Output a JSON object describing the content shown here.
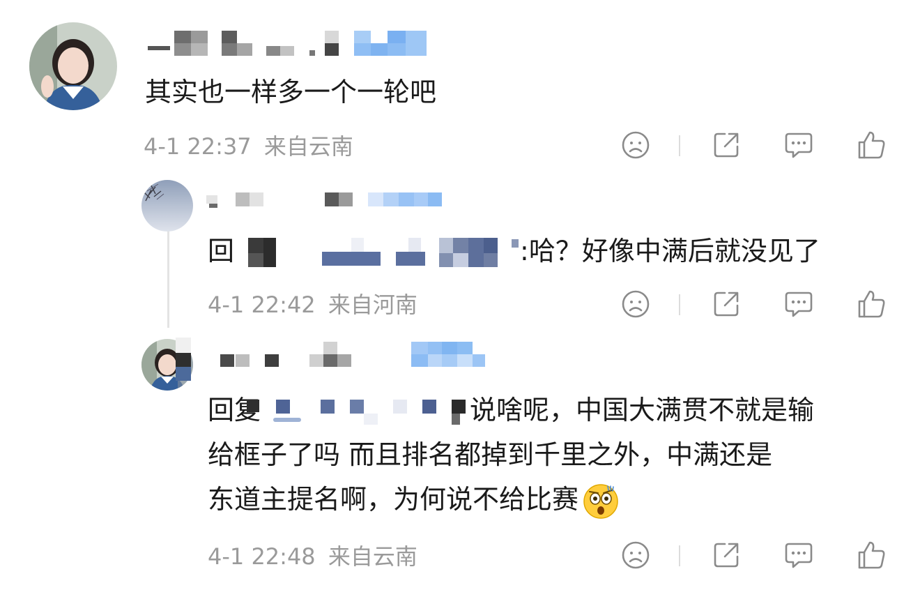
{
  "comments": [
    {
      "text": "其实也一样多一个一轮吧",
      "time": "4-1 22:37",
      "location": "来自云南"
    },
    {
      "text": ":哈？好像中满后就没见了",
      "reply_prefix": "回",
      "time": "4-1 22:42",
      "location": "来自河南"
    },
    {
      "reply_prefix": "回复",
      "line1": "说啥呢，中国大满贯不就是输",
      "line2": "给框子了吗 而且排名都掉到千里之外，中满还是",
      "line3": "东道主提名啊，为何说不给比赛",
      "time": "4-1 22:48",
      "location": "来自云南"
    }
  ],
  "icons": [
    "sad-face-icon",
    "share-icon",
    "comment-icon",
    "like-icon"
  ]
}
